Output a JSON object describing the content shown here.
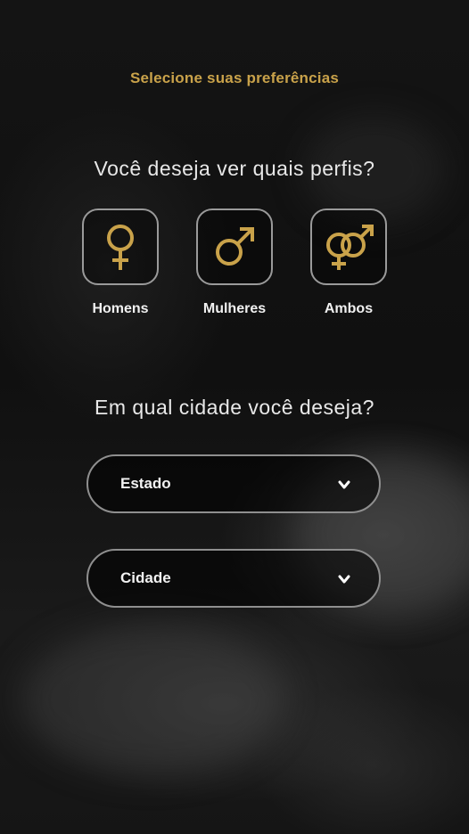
{
  "header": {
    "title": "Selecione suas preferências"
  },
  "profiles": {
    "question": "Você deseja ver quais perfis?",
    "options": [
      {
        "label": "Homens",
        "icon": "female-symbol-icon"
      },
      {
        "label": "Mulheres",
        "icon": "male-symbol-icon"
      },
      {
        "label": "Ambos",
        "icon": "both-genders-icon"
      }
    ]
  },
  "location": {
    "question": "Em qual cidade você deseja?",
    "state_select": {
      "value": "Estado",
      "icon": "chevron-down-icon"
    },
    "city_select": {
      "value": "Cidade",
      "icon": "chevron-down-icon"
    }
  },
  "colors": {
    "accent_gold": "#c9a24a",
    "background": "#111111",
    "border_gray": "#9a9a9a",
    "text_light": "#f0f0f0"
  }
}
